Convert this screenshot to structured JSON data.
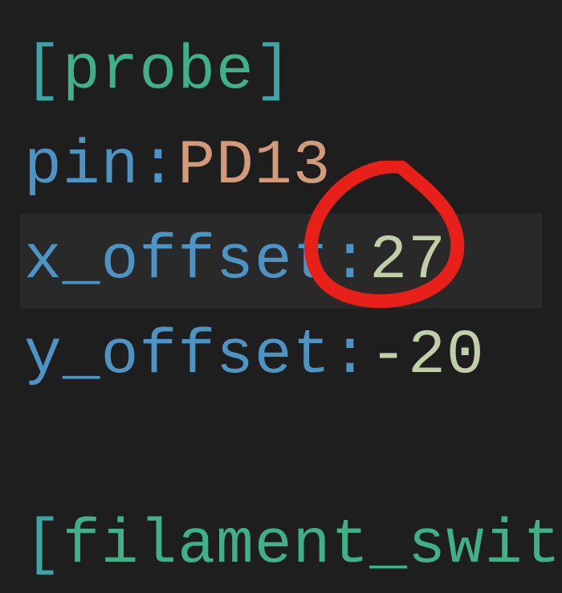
{
  "code": {
    "section_open_bracket": "[",
    "section_name": "probe",
    "section_close_bracket": "]",
    "pin_key": "pin",
    "pin_value": "PD13",
    "x_offset_key": "x_offset",
    "x_offset_value": "27",
    "y_offset_key": "y_offset",
    "y_offset_value": "-20",
    "next_section_partial_open": "[",
    "next_section_partial_name": "filament_swit"
  },
  "colors": {
    "background": "#1e1e1e",
    "bracket": "#3ca6a6",
    "section": "#3fb088",
    "key": "#4d94c4",
    "pin_value": "#d19a7a",
    "number": "#c1cfa8",
    "annotation": "#e8201a"
  },
  "highlight_line_index": 2
}
